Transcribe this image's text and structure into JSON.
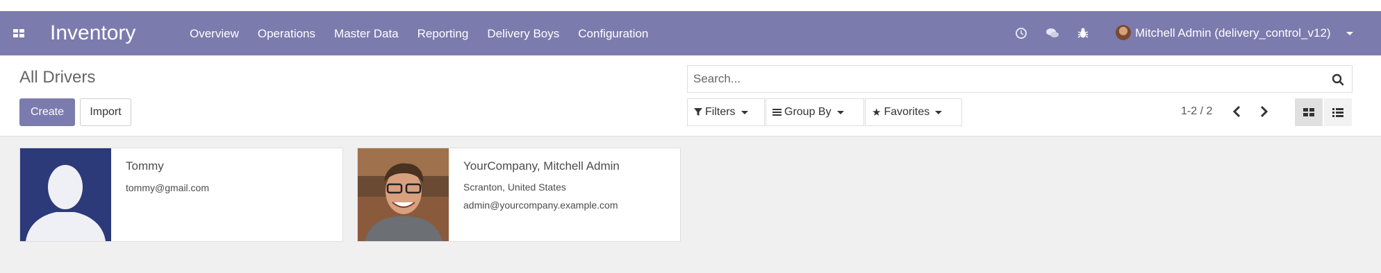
{
  "app": {
    "title": "Inventory",
    "menu": [
      "Overview",
      "Operations",
      "Master Data",
      "Reporting",
      "Delivery Boys",
      "Configuration"
    ],
    "user": "Mitchell Admin (delivery_control_v12)",
    "accent": "#7c7bad"
  },
  "control": {
    "breadcrumb": "All Drivers",
    "create_label": "Create",
    "import_label": "Import",
    "search_placeholder": "Search...",
    "filters_label": "Filters",
    "groupby_label": "Group By",
    "favorites_label": "Favorites",
    "pager": "1-2 / 2"
  },
  "cards": [
    {
      "name": "Tommy",
      "lines": [
        "tommy@gmail.com"
      ],
      "image": "placeholder-avatar"
    },
    {
      "name": "YourCompany, Mitchell Admin",
      "lines": [
        "Scranton, United States",
        "admin@yourcompany.example.com"
      ],
      "image": "photo-avatar"
    }
  ]
}
